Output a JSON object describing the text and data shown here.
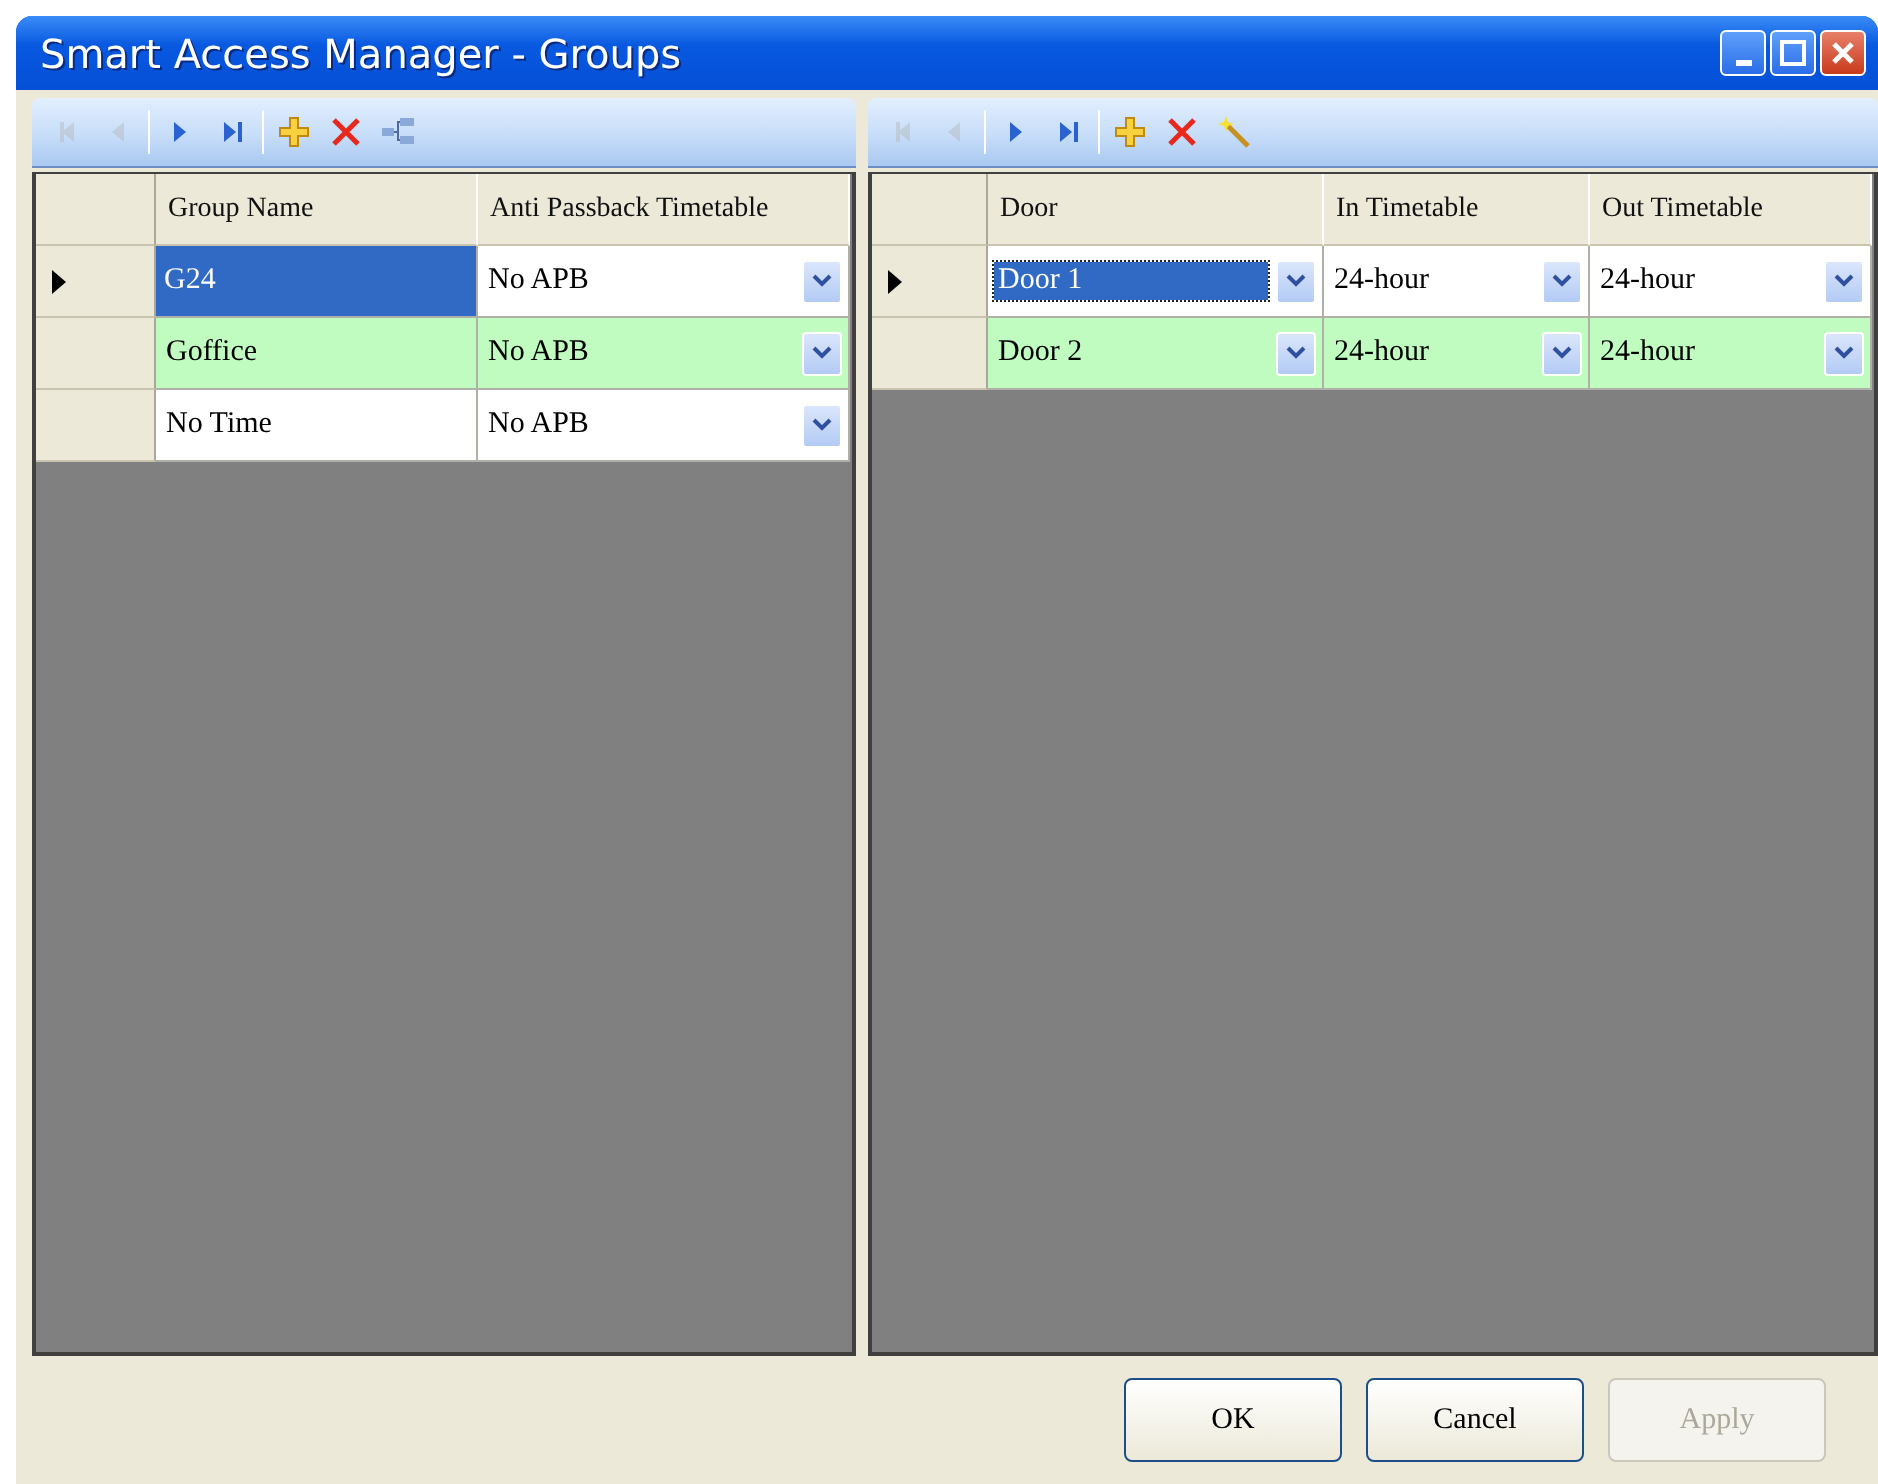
{
  "window": {
    "title": "Smart Access Manager - Groups"
  },
  "panels": [
    {
      "toolbar": [
        {
          "kind": "first",
          "disabled": true
        },
        {
          "kind": "previous",
          "disabled": true
        },
        {
          "kind": "separator"
        },
        {
          "kind": "next",
          "disabled": false
        },
        {
          "kind": "last",
          "disabled": false
        },
        {
          "kind": "separator"
        },
        {
          "kind": "add",
          "disabled": false
        },
        {
          "kind": "delete",
          "disabled": false
        },
        {
          "kind": "tree",
          "disabled": false
        }
      ],
      "columns": [
        "Group Name",
        "Anti Passback Timetable"
      ],
      "rows": [
        {
          "selected": true,
          "cells": [
            {
              "text": "G24",
              "focused": true,
              "kind": "text"
            },
            {
              "text": "No APB",
              "focused": false,
              "kind": "combo"
            }
          ]
        },
        {
          "selected": false,
          "cells": [
            {
              "text": "Goffice",
              "focused": false,
              "kind": "text"
            },
            {
              "text": "No APB",
              "focused": false,
              "kind": "combo"
            }
          ]
        },
        {
          "selected": false,
          "cells": [
            {
              "text": "No Time",
              "focused": false,
              "kind": "text"
            },
            {
              "text": "No APB",
              "focused": false,
              "kind": "combo"
            }
          ]
        }
      ]
    },
    {
      "toolbar": [
        {
          "kind": "first",
          "disabled": true
        },
        {
          "kind": "previous",
          "disabled": true
        },
        {
          "kind": "separator"
        },
        {
          "kind": "next",
          "disabled": false
        },
        {
          "kind": "last",
          "disabled": false
        },
        {
          "kind": "separator"
        },
        {
          "kind": "add",
          "disabled": false
        },
        {
          "kind": "delete",
          "disabled": false
        },
        {
          "kind": "wand",
          "disabled": false
        }
      ],
      "columns": [
        "Door",
        "In Timetable",
        "Out Timetable"
      ],
      "rows": [
        {
          "selected": true,
          "cells": [
            {
              "text": "Door 1",
              "focused": true,
              "kind": "combo"
            },
            {
              "text": "24-hour",
              "focused": false,
              "kind": "combo"
            },
            {
              "text": "24-hour",
              "focused": false,
              "kind": "combo"
            }
          ]
        },
        {
          "selected": false,
          "cells": [
            {
              "text": "Door 2",
              "focused": false,
              "kind": "combo"
            },
            {
              "text": "24-hour",
              "focused": false,
              "kind": "combo"
            },
            {
              "text": "24-hour",
              "focused": false,
              "kind": "combo"
            }
          ]
        }
      ]
    }
  ],
  "buttons": [
    {
      "label": "OK",
      "disabled": false
    },
    {
      "label": "Cancel",
      "disabled": false
    },
    {
      "label": "Apply",
      "disabled": true
    }
  ]
}
